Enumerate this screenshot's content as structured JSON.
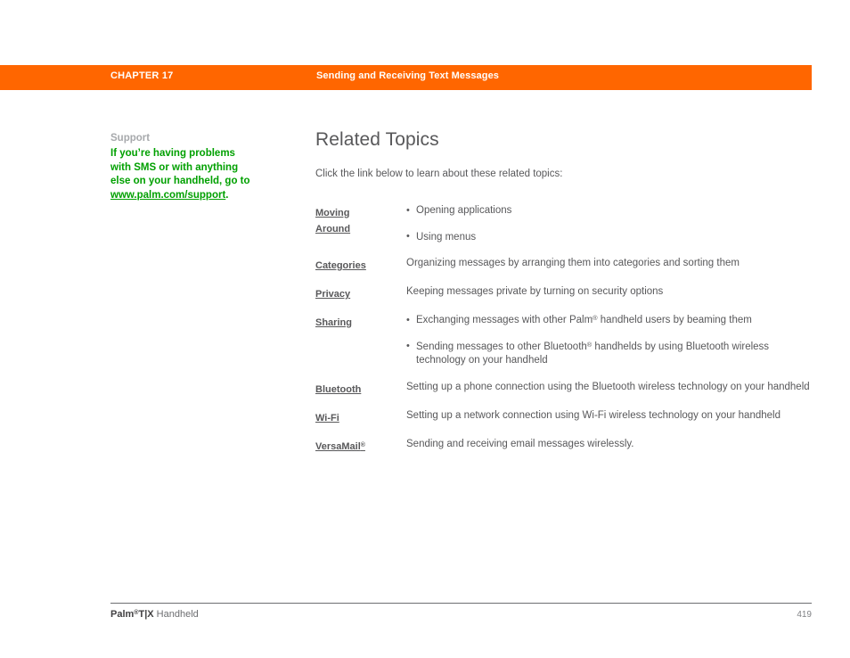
{
  "header": {
    "chapter_label": "CHAPTER 17",
    "title": "Sending and Receiving Text Messages",
    "bar_color": "#ff6600"
  },
  "sidebar": {
    "heading": "Support",
    "body_line1": "If you’re having problems",
    "body_line2": "with SMS or with anything",
    "body_line3": "else on your handheld, go to",
    "link_text": "www.palm.com/support",
    "link_suffix": ".",
    "link_color": "#00a000",
    "heading_color": "#a7a9ac"
  },
  "main": {
    "page_title": "Related Topics",
    "intro": "Click the link below to learn about these related topics:",
    "topics": [
      {
        "link": "Moving Around",
        "link_line1": "Moving ",
        "link_line2": "Around",
        "bullets": [
          "Opening applications",
          "Using menus"
        ]
      },
      {
        "link": "Categories",
        "description": "Organizing messages by arranging them into categories and sorting them"
      },
      {
        "link": "Privacy",
        "description": "Keeping messages private by turning on security options"
      },
      {
        "link": "Sharing",
        "bullet1_pre": "Exchanging messages with other Palm",
        "bullet1_sup": "®",
        "bullet1_post": " handheld users by beaming them",
        "bullet2_pre": "Sending messages to other Bluetooth",
        "bullet2_sup": "®",
        "bullet2_post": " handhelds by using Bluetooth wireless technology on your handheld"
      },
      {
        "link": "Bluetooth",
        "description": "Setting up a phone connection using the Bluetooth wireless technology on your handheld"
      },
      {
        "link": "Wi-Fi",
        "description": "Setting up a network connection using Wi-Fi wireless technology on your handheld"
      },
      {
        "link_pre": "VersaMail",
        "link_sup": "®",
        "description": "Sending and receiving email messages wirelessly."
      }
    ]
  },
  "footer": {
    "brand": "Palm",
    "brand_sup": "®",
    "model": "T|X",
    "product": " Handheld",
    "page_number": "419"
  }
}
